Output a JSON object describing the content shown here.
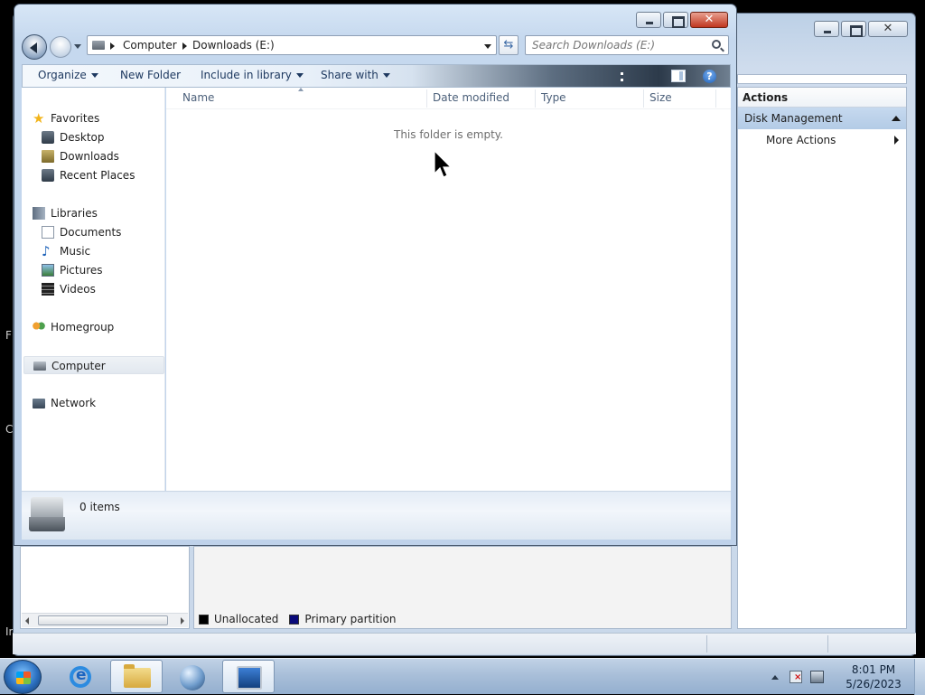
{
  "desktop": {
    "edge_fragments": [
      "F",
      "C",
      "In"
    ]
  },
  "mmc": {
    "actions_title": "Actions",
    "section_label": "Disk Management",
    "more_actions_label": "More Actions",
    "legend": [
      {
        "label": "Unallocated",
        "color": "#000000"
      },
      {
        "label": "Primary partition",
        "color": "#0a0a7a"
      }
    ]
  },
  "explorer": {
    "address": {
      "segments": [
        "Computer",
        "Downloads (E:)"
      ]
    },
    "search": {
      "placeholder": "Search Downloads (E:)"
    },
    "commands": {
      "organize": "Organize",
      "new_folder": "New Folder",
      "include_in_library": "Include in library",
      "share_with": "Share with"
    },
    "nav": {
      "favorites": "Favorites",
      "desktop": "Desktop",
      "downloads": "Downloads",
      "recent_places": "Recent Places",
      "libraries": "Libraries",
      "documents": "Documents",
      "music": "Music",
      "pictures": "Pictures",
      "videos": "Videos",
      "homegroup": "Homegroup",
      "computer": "Computer",
      "network": "Network"
    },
    "columns": {
      "name": "Name",
      "date_modified": "Date modified",
      "type": "Type",
      "size": "Size"
    },
    "empty_message": "This folder is empty.",
    "details": {
      "item_count": "0 items"
    }
  },
  "taskbar": {
    "time": "8:01 PM",
    "date": "5/26/2023"
  }
}
